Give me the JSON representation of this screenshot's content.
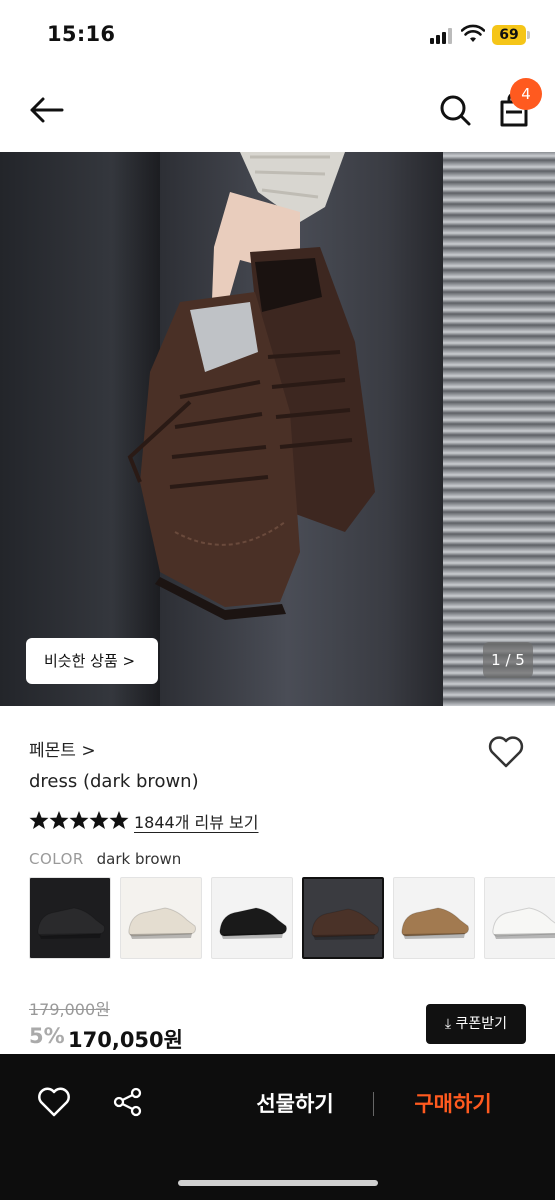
{
  "status_bar": {
    "time": "15:16",
    "battery": "69"
  },
  "header": {
    "cart_count": "4"
  },
  "hero": {
    "similar_button_label": "비슷한 상품 >",
    "page_indicator": "1 / 5"
  },
  "product": {
    "brand": "페몬트 >",
    "name": "dress (dark brown)",
    "rating": 5,
    "review_link": "1844개 리뷰 보기",
    "color_label": "COLOR",
    "color_value": "dark brown",
    "original_price": "179,000원",
    "discount": "5%",
    "sale_price": "170,050원",
    "coupon_label": "⤓ 쿠폰받기"
  },
  "swatches": [
    {
      "name": "black-box",
      "bg": "#1d1d1f",
      "shoe": "#2a2a2c"
    },
    {
      "name": "cream",
      "bg": "#f4f2ee",
      "shoe": "#e4ddd0"
    },
    {
      "name": "black",
      "bg": "#f3f3f3",
      "shoe": "#1a1a1a"
    },
    {
      "name": "dark-brown",
      "bg": "#3a3b40",
      "shoe": "#4a3228",
      "selected": true
    },
    {
      "name": "tan",
      "bg": "#f3f3f3",
      "shoe": "#a27a50"
    },
    {
      "name": "white",
      "bg": "#f3f3f3",
      "shoe": "#f7f7f5"
    }
  ],
  "bottom_bar": {
    "gift_label": "선물하기",
    "buy_label": "구매하기"
  },
  "colors": {
    "accent": "#ff5a1f",
    "dark": "#0d0d0d"
  },
  "icons": [
    "back-arrow-icon",
    "search-icon",
    "cart-icon",
    "heart-icon",
    "share-icon",
    "star-icon",
    "download-icon"
  ]
}
